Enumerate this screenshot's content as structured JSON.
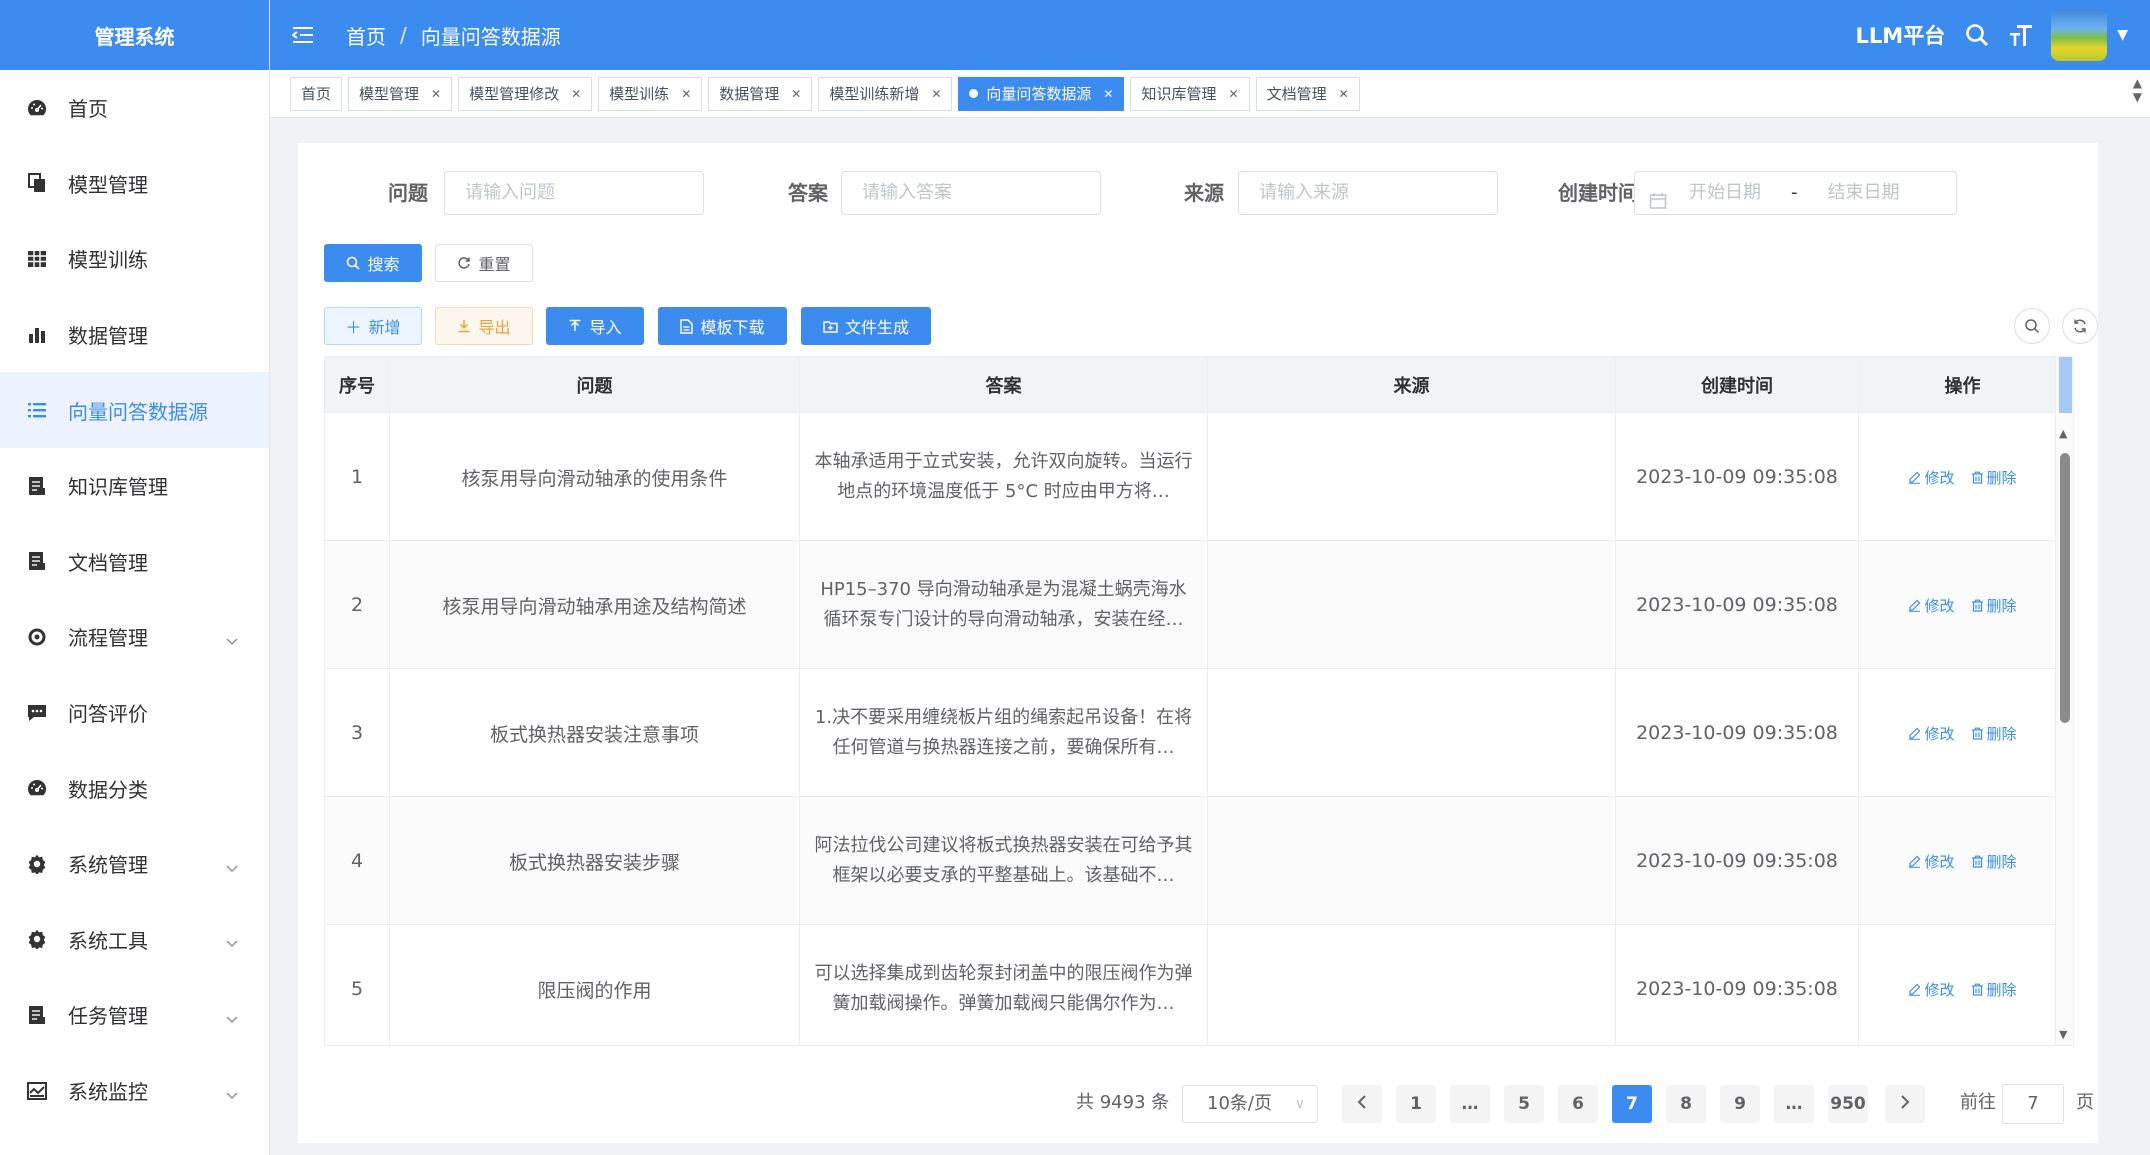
{
  "app": {
    "title": "管理系统",
    "platform": "LLM平台"
  },
  "sidebar": {
    "items": [
      {
        "label": "首页",
        "icon": "dashboard-icon"
      },
      {
        "label": "模型管理",
        "icon": "copy-icon"
      },
      {
        "label": "模型训练",
        "icon": "table-icon"
      },
      {
        "label": "数据管理",
        "icon": "bar-chart-icon"
      },
      {
        "label": "向量问答数据源",
        "icon": "list-icon",
        "active": true
      },
      {
        "label": "知识库管理",
        "icon": "document-icon"
      },
      {
        "label": "文档管理",
        "icon": "document-icon"
      },
      {
        "label": "流程管理",
        "icon": "flow-icon",
        "expandable": true
      },
      {
        "label": "问答评价",
        "icon": "message-icon"
      },
      {
        "label": "数据分类",
        "icon": "dashboard-icon"
      },
      {
        "label": "系统管理",
        "icon": "gear-icon",
        "expandable": true
      },
      {
        "label": "系统工具",
        "icon": "gear-icon",
        "expandable": true
      },
      {
        "label": "任务管理",
        "icon": "document-icon",
        "expandable": true
      },
      {
        "label": "系统监控",
        "icon": "monitor-icon",
        "expandable": true
      }
    ]
  },
  "header": {
    "breadcrumb": [
      "首页",
      "向量问答数据源"
    ]
  },
  "tags": [
    {
      "label": "首页",
      "closable": false
    },
    {
      "label": "模型管理",
      "closable": true
    },
    {
      "label": "模型管理修改",
      "closable": true
    },
    {
      "label": "模型训练",
      "closable": true
    },
    {
      "label": "数据管理",
      "closable": true
    },
    {
      "label": "模型训练新增",
      "closable": true
    },
    {
      "label": "向量问答数据源",
      "closable": true,
      "active": true
    },
    {
      "label": "知识库管理",
      "closable": true
    },
    {
      "label": "文档管理",
      "closable": true
    }
  ],
  "search": {
    "question_label": "问题",
    "question_placeholder": "请输入问题",
    "answer_label": "答案",
    "answer_placeholder": "请输入答案",
    "source_label": "来源",
    "source_placeholder": "请输入来源",
    "created_label": "创建时间",
    "start_placeholder": "开始日期",
    "range_sep": "-",
    "end_placeholder": "结束日期",
    "search_btn": "搜索",
    "reset_btn": "重置"
  },
  "toolbar": {
    "add": "新增",
    "export": "导出",
    "import": "导入",
    "template": "模板下载",
    "generate": "文件生成"
  },
  "table": {
    "columns": [
      "序号",
      "问题",
      "答案",
      "来源",
      "创建时间",
      "操作"
    ],
    "edit_label": "修改",
    "delete_label": "删除",
    "rows": [
      {
        "no": "1",
        "question": "核泵用导向滑动轴承的使用条件",
        "answer": "本轴承适用于立式安装，允许双向旋转。当运行地点的环境温度低于 5°C 时应由甲方将…",
        "source": "",
        "created": "2023-10-09 09:35:08"
      },
      {
        "no": "2",
        "question": "核泵用导向滑动轴承用途及结构简述",
        "answer": "HP15–370 导向滑动轴承是为混凝土蜗壳海水循环泵专门设计的导向滑动轴承，安装在经…",
        "source": "",
        "created": "2023-10-09 09:35:08"
      },
      {
        "no": "3",
        "question": "板式换热器安装注意事项",
        "answer": "1.决不要采用缠绕板片组的绳索起吊设备！在将任何管道与换热器连接之前，要确保所有…",
        "source": "",
        "created": "2023-10-09 09:35:08"
      },
      {
        "no": "4",
        "question": "板式换热器安装步骤",
        "answer": "阿法拉伐公司建议将板式换热器安装在可给予其框架以必要支承的平整基础上。该基础不…",
        "source": "",
        "created": "2023-10-09 09:35:08"
      },
      {
        "no": "5",
        "question": "限压阀的作用",
        "answer": "可以选择集成到齿轮泵封闭盖中的限压阀作为弹簧加载阀操作。弹簧加载阀只能偶尔作为…",
        "source": "",
        "created": "2023-10-09 09:35:08"
      }
    ]
  },
  "pagination": {
    "total": "共 9493 条",
    "page_size": "10条/页",
    "pages": [
      "1",
      "…",
      "5",
      "6",
      "7",
      "8",
      "9",
      "…",
      "950"
    ],
    "current": "7",
    "goto_label": "前往",
    "goto_value": "7",
    "goto_suffix": "页"
  },
  "colors": {
    "primary": "#3c8cf0",
    "warning": "#e6a23c"
  }
}
